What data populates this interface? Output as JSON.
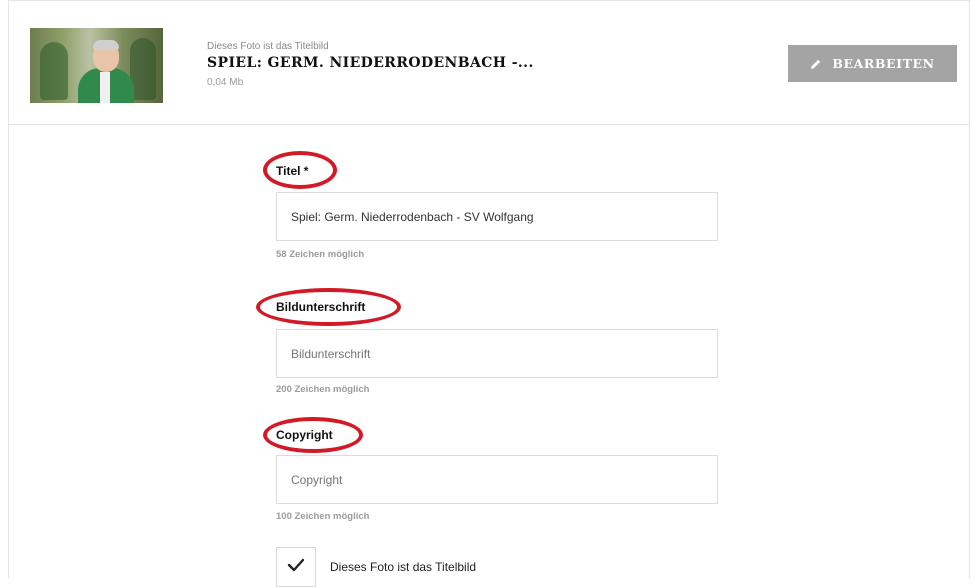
{
  "header": {
    "subtitle": "Dieses Foto ist das Titelbild",
    "title": "SPIEL: GERM. NIEDERRODENBACH -...",
    "file_size": "0,04 Mb",
    "edit_button_label": "BEARBEITEN",
    "thumbnail_icon": "photo-thumbnail"
  },
  "form": {
    "title_field": {
      "label": "Titel *",
      "value": "Spiel: Germ. Niederrodenbach - SV Wolfgang",
      "hint": "58 Zeichen möglich"
    },
    "caption_field": {
      "label": "Bildunterschrift",
      "placeholder": "Bildunterschrift",
      "hint": "200 Zeichen möglich"
    },
    "copyright_field": {
      "label": "Copyright",
      "placeholder": "Copyright",
      "hint": "100 Zeichen möglich"
    },
    "cover_checkbox": {
      "label": "Dieses Foto ist das Titelbild",
      "checked": true
    }
  },
  "colors": {
    "annotation": "#d21a26",
    "button_bg": "#a4a4a4"
  },
  "icons": {
    "edit": "pencil-icon",
    "check": "checkmark-icon"
  }
}
